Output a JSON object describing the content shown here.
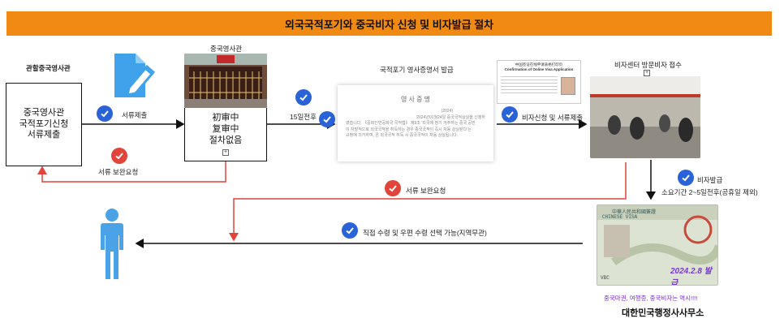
{
  "title": "외국국적포기와 중국비자 신청 및 비자발급 절차",
  "consulate_jurisdiction_label": "관할중국영사관",
  "consulate_box": {
    "lines": [
      "중국영사관",
      "국적포기신청",
      "서류제출"
    ]
  },
  "submit_label": "서류제출",
  "china_consulate_label": "중국영사관",
  "status_box": {
    "lines": [
      "初审中",
      "复审中",
      "절차없음"
    ]
  },
  "supplement_label_1": "서류 보완요청",
  "days_label": "15일전후",
  "cert_label": "국적포기 영사증명서 발급",
  "cert_doc": {
    "heading": "영 사 증 명",
    "line1": "(2024)",
    "line2": "2024년01월24일 중국국적상실을 신청하",
    "line3": "였습니다. 《중화인민공화국 국적법》 제9조 '외국에 정기 거주하는 중국 공민",
    "line4": "이 자발적으로 외국국적을 취득하는 경우 중국국적이 즉시 자동 상실된다'는",
    "line5": "규정에 의거하여,        은 외국국적 취득 시 중국국적이 자동 상실됩니다."
  },
  "visa_form": {
    "title_cn": "中国签证在线申请表格打印页",
    "title_en": "Confirmation of Online Visa Application"
  },
  "visa_apply_label": "비자신청 및 서류제출",
  "visa_center_label": "비자센터 방문비자 접수",
  "supplement_label_2": "서류 보완요청",
  "visa_issue_label": "비자발급",
  "visa_period_label": "소요기간 2~5일전후(공휴일 제외)",
  "receive_label": "직접 수령 및 우편 수령 선택 가능(지역무관)",
  "visa_sticker": {
    "header": "中華人民共和國簽證",
    "type": "CHINESE VISA",
    "stamp": "2024.2.8 발급",
    "mrz": "VBC"
  },
  "footer_tagline": "중국마권, 여행증, 중국비자는 역시!!!!",
  "footer_company": "대한민국행정사사무소",
  "colors": {
    "banner": "#f08a12",
    "check_blue": "#2a63d8",
    "check_red": "#e0443a",
    "arrow_red": "#e0443a",
    "person": "#4aa3e6"
  },
  "icons": [
    "document-edit-icon",
    "check-icon",
    "person-icon",
    "expand-icon"
  ]
}
